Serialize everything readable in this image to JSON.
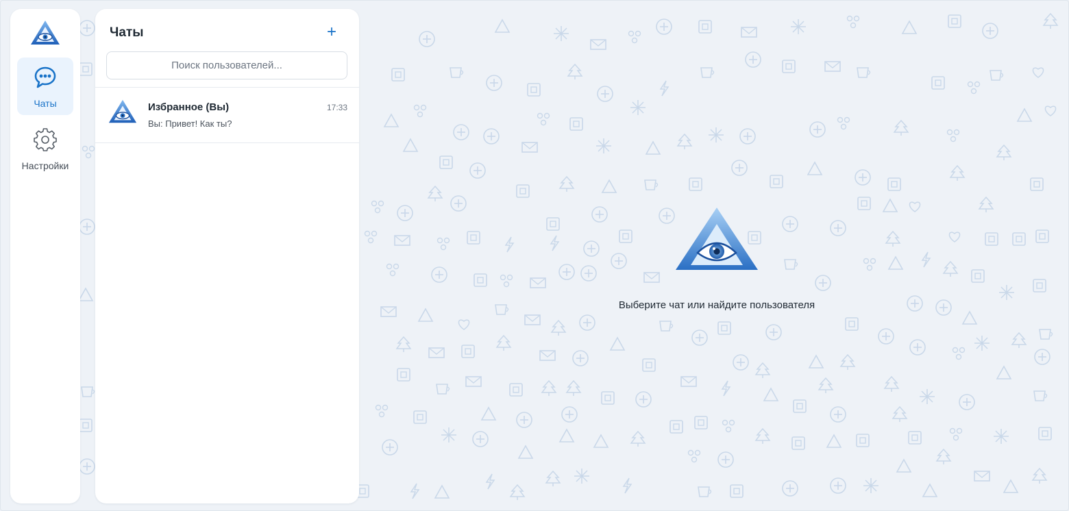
{
  "colors": {
    "accent": "#1a73c8",
    "background": "#eef2f7",
    "panel": "#ffffff",
    "pattern": "#c7d6e8"
  },
  "sidebar": {
    "logo_icon": "eye-triangle-logo-icon",
    "items": [
      {
        "label": "Чаты",
        "icon": "chat-bubble-icon",
        "active": true
      },
      {
        "label": "Настройки",
        "icon": "gear-icon",
        "active": false
      }
    ]
  },
  "chats_panel": {
    "title": "Чаты",
    "add_label": "+",
    "search": {
      "placeholder": "Поиск пользователей...",
      "value": ""
    },
    "items": [
      {
        "name": "Избранное (Вы)",
        "time": "17:33",
        "preview": "Вы: Привет! Как ты?",
        "avatar_icon": "eye-triangle-logo-icon"
      }
    ]
  },
  "main": {
    "empty_state_text": "Выберите чат или найдите пользователя",
    "empty_state_icon": "eye-triangle-logo-icon"
  }
}
